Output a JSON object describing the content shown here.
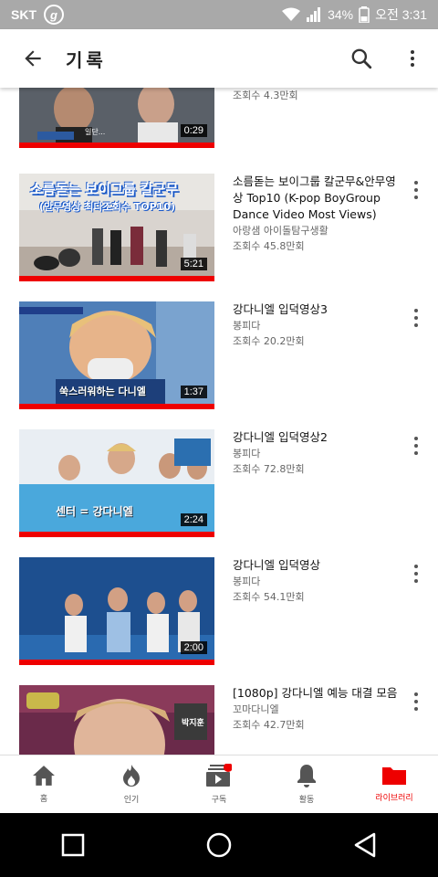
{
  "status": {
    "carrier": "SKT",
    "carrier_badge": "g",
    "battery": "34%",
    "time": "오전 3:31"
  },
  "header": {
    "title": "기록",
    "back_icon": "arrow-left-icon",
    "search_icon": "search-icon",
    "more_icon": "more-vert-icon"
  },
  "videos": [
    {
      "title": "",
      "channel": "",
      "views": "조회수 4.3만회",
      "duration": "0:29",
      "thumb_caption": "일단..."
    },
    {
      "title": "소름돋는 보이그룹 칼군무&안무영상 Top10 (K-pop BoyGroup Dance Video Most Views)",
      "channel": "아랑샘 아이돌탐구생활",
      "views": "조회수 45.8만회",
      "duration": "5:21",
      "thumb_line1": "소름돋는 보이그룹 칼군무",
      "thumb_line2": "(안무영상 최다조회수 TOP10)"
    },
    {
      "title": "강다니엘 입덕영상3",
      "channel": "봉피다",
      "views": "조회수 20.2만회",
      "duration": "1:37",
      "thumb_caption": "쑥스러워하는 다니엘"
    },
    {
      "title": "강다니엘 입덕영상2",
      "channel": "봉피다",
      "views": "조회수 72.8만회",
      "duration": "2:24",
      "thumb_caption": "센터 = 강다니엘"
    },
    {
      "title": "강다니엘 입덕영상",
      "channel": "봉피다",
      "views": "조회수 54.1만회",
      "duration": "2:00"
    },
    {
      "title": "[1080p] 강다니엘 예능 대결 모음",
      "channel": "꼬마다니엘",
      "views": "조회수 42.7만회",
      "duration": "",
      "thumb_caption": "박지훈"
    }
  ],
  "bottom_nav": [
    {
      "label": "홈",
      "icon": "home-icon"
    },
    {
      "label": "인기",
      "icon": "fire-icon"
    },
    {
      "label": "구독",
      "icon": "subscriptions-icon"
    },
    {
      "label": "활동",
      "icon": "bell-icon"
    },
    {
      "label": "라이브러리",
      "icon": "folder-icon"
    }
  ],
  "colors": {
    "accent": "#ee0000",
    "status_bar": "#a9a9a9"
  }
}
